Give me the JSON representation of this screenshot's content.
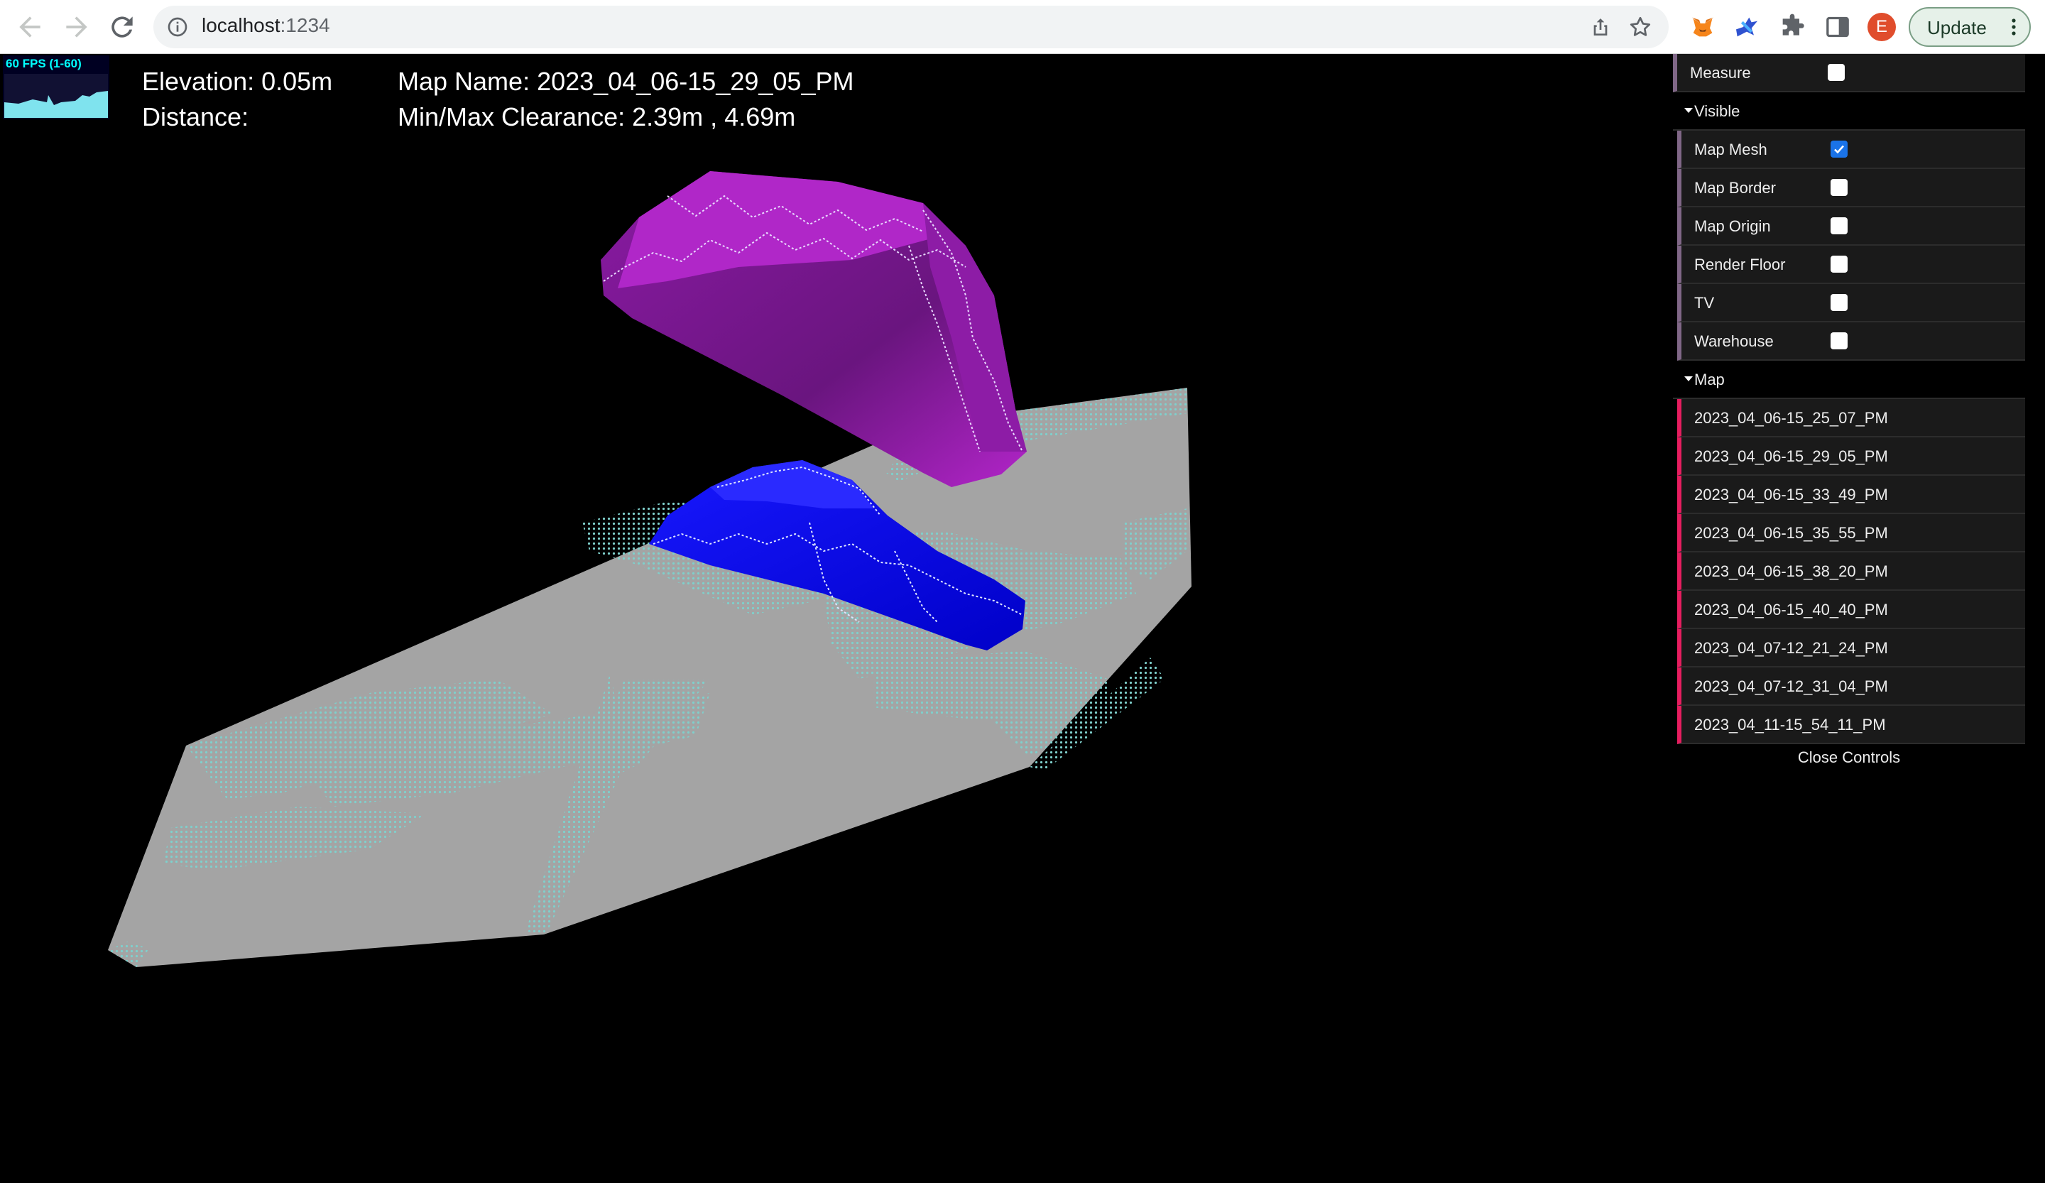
{
  "browser": {
    "url_host": "localhost",
    "url_port": ":1234",
    "profile_initial": "E",
    "update_label": "Update",
    "icons": [
      "back-arrow-icon",
      "forward-arrow-icon",
      "reload-icon",
      "info-icon",
      "share-icon",
      "star-icon",
      "metamask-fox-icon",
      "extension-icon",
      "puzzle-icon",
      "sidebar-icon",
      "more-vert-icon"
    ]
  },
  "stats": {
    "fps_label": "60 FPS (1-60)"
  },
  "hud": {
    "elevation": "Elevation: 0.05m",
    "distance": "Distance:",
    "map_name": "Map Name: 2023_04_06-15_29_05_PM",
    "clearance": "Min/Max Clearance: 2.39m , 4.69m"
  },
  "controls": {
    "measure": {
      "label": "Measure",
      "checked": false
    },
    "visible_folder": "Visible",
    "visible_items": [
      {
        "label": "Map Mesh",
        "checked": true
      },
      {
        "label": "Map Border",
        "checked": false
      },
      {
        "label": "Map Origin",
        "checked": false
      },
      {
        "label": "Render Floor",
        "checked": false
      },
      {
        "label": "TV",
        "checked": false
      },
      {
        "label": "Warehouse",
        "checked": false
      }
    ],
    "map_folder": "Map",
    "maps": [
      "2023_04_06-15_25_07_PM",
      "2023_04_06-15_29_05_PM",
      "2023_04_06-15_33_49_PM",
      "2023_04_06-15_35_55_PM",
      "2023_04_06-15_38_20_PM",
      "2023_04_06-15_40_40_PM",
      "2023_04_07-12_21_24_PM",
      "2023_04_07-12_31_04_PM",
      "2023_04_11-15_54_11_PM"
    ],
    "close_label": "Close Controls"
  },
  "colors": {
    "floor": "#a4a4a4",
    "floor_points": "#7fd0cc",
    "upper_mesh": "#a51fbf",
    "lower_mesh": "#0a0af0",
    "checkbox_checked": "#1a73e8",
    "bool_accent": "#806787",
    "function_accent": "#e61d5f"
  }
}
